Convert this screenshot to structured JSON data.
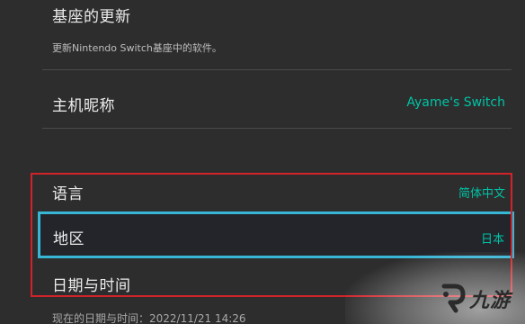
{
  "settings": {
    "update": {
      "title": "基座的更新",
      "description": "更新Nintendo Switch基座中的软件。"
    },
    "nickname": {
      "label": "主机昵称",
      "value": "Ayame's Switch"
    },
    "language": {
      "label": "语言",
      "value": "简体中文"
    },
    "region": {
      "label": "地区",
      "value": "日本"
    },
    "datetime": {
      "label": "日期与时间",
      "current": "现在的日期与时间：2022/11/21 14:26"
    }
  },
  "watermark": {
    "text": "九游",
    "icon": "jiuyou-logo-icon"
  },
  "colors": {
    "background": "#2d2d2d",
    "accent_value": "#00c3a5",
    "selection_border": "#38b6d6",
    "annotation_box": "#d2232a"
  }
}
